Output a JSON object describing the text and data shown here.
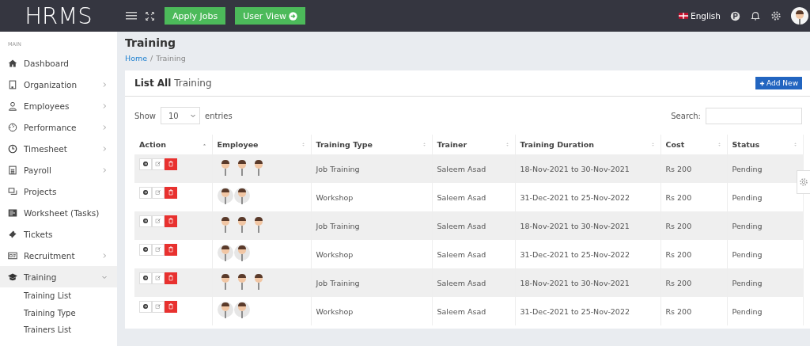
{
  "header": {
    "logo": "HRMS",
    "buttons": [
      {
        "label": "Apply Jobs",
        "kind": "plain"
      },
      {
        "label": "User View",
        "kind": "arrow"
      }
    ],
    "language": "English"
  },
  "sidebar": {
    "section": "MAIN",
    "items": [
      {
        "label": "Dashboard",
        "selected": false
      },
      {
        "label": "Organization",
        "expanded": false,
        "selected": false
      },
      {
        "label": "Employees",
        "expanded": false,
        "selected": false
      },
      {
        "label": "Performance",
        "expanded": false,
        "selected": false
      },
      {
        "label": "Timesheet",
        "expanded": false,
        "selected": false
      },
      {
        "label": "Payroll",
        "expanded": false,
        "selected": false
      },
      {
        "label": "Projects",
        "selected": false
      },
      {
        "label": "Worksheet (Tasks)",
        "selected": false
      },
      {
        "label": "Tickets",
        "selected": false
      },
      {
        "label": "Recruitment",
        "expanded": false,
        "selected": false
      },
      {
        "label": "Training",
        "expanded": true,
        "selected": true,
        "children": [
          {
            "label": "Training List"
          },
          {
            "label": "Training Type"
          },
          {
            "label": "Trainers List"
          }
        ]
      }
    ]
  },
  "page": {
    "title": "Training",
    "breadcrumb": [
      "Home",
      "Training"
    ],
    "separator": "/"
  },
  "card": {
    "title_bold": "List All",
    "title": "Training",
    "add_button": "Add New",
    "show_label": "Show",
    "page_size": "10",
    "entries_label": "entries",
    "search_label": "Search:"
  },
  "table": {
    "columns": [
      {
        "label": "Action",
        "sorted": true
      },
      {
        "label": "Employee",
        "sorted": false
      },
      {
        "label": "Training Type",
        "sorted": false
      },
      {
        "label": "Trainer",
        "sorted": false
      },
      {
        "label": "Training Duration",
        "sorted": false
      },
      {
        "label": "Cost",
        "sorted": false
      },
      {
        "label": "Status",
        "sorted": false
      }
    ],
    "rows": [
      {
        "employees": [
          {
            "kind": "avatar"
          },
          {
            "kind": "avatar"
          },
          {
            "kind": "avatar"
          }
        ],
        "type": "Job Training",
        "trainer": "Saleem Asad",
        "duration": "18-Nov-2021 to 30-Nov-2021",
        "cost": "Rs 200",
        "status": "Pending"
      },
      {
        "employees": [
          {
            "kind": "avatar"
          },
          {
            "kind": "avatar"
          }
        ],
        "type": "Workshop",
        "trainer": "Saleem Asad",
        "duration": "31-Dec-2021 to 25-Nov-2022",
        "cost": "Rs 200",
        "status": "Pending"
      },
      {
        "employees": [
          {
            "kind": "avatar"
          },
          {
            "kind": "avatar"
          },
          {
            "kind": "avatar"
          }
        ],
        "type": "Job Training",
        "trainer": "Saleem Asad",
        "duration": "18-Nov-2021 to 30-Nov-2021",
        "cost": "Rs 200",
        "status": "Pending"
      },
      {
        "employees": [
          {
            "kind": "avatar"
          },
          {
            "kind": "avatar"
          }
        ],
        "type": "Workshop",
        "trainer": "Saleem Asad",
        "duration": "31-Dec-2021 to 25-Nov-2022",
        "cost": "Rs 200",
        "status": "Pending"
      },
      {
        "employees": [
          {
            "kind": "avatar"
          },
          {
            "kind": "avatar"
          },
          {
            "kind": "avatar"
          }
        ],
        "type": "Job Training",
        "trainer": "Saleem Asad",
        "duration": "18-Nov-2021 to 30-Nov-2021",
        "cost": "Rs 200",
        "status": "Pending"
      },
      {
        "employees": [
          {
            "kind": "avatar"
          },
          {
            "kind": "avatar"
          }
        ],
        "type": "Workshop",
        "trainer": "Saleem Asad",
        "duration": "31-Dec-2021 to 25-Nov-2022",
        "cost": "Rs 200",
        "status": "Pending"
      }
    ]
  }
}
